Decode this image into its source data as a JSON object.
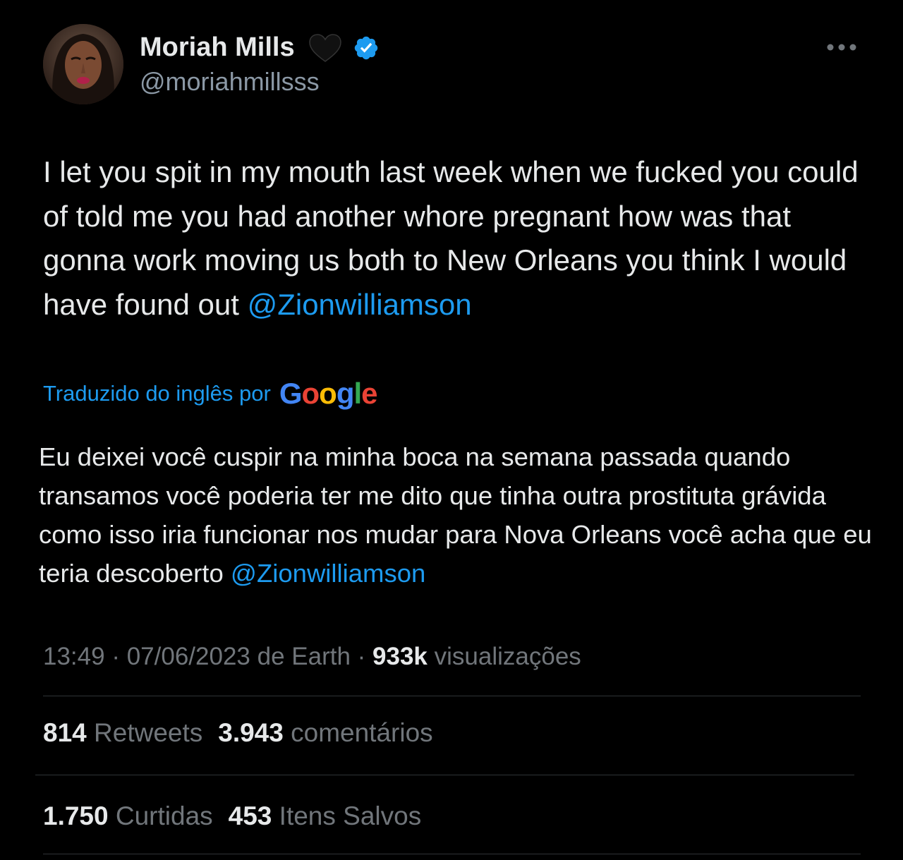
{
  "author": {
    "display_name": "Moriah Mills",
    "emoji": "🖤",
    "handle": "@moriahmillsss",
    "verified": true,
    "verified_color": "#1d9bf0"
  },
  "tweet": {
    "text": "I let you spit in my mouth last week when we fucked you could of told me you had another whore pregnant how was that gonna work moving us both to New Orleans you think I would have found out ",
    "mention": "@Zionwilliamson"
  },
  "translation": {
    "label": "Traduzido do inglês por",
    "provider": "Google",
    "text": "Eu deixei você cuspir na minha boca na semana passada quando transamos você poderia ter me dito que tinha outra prostituta grávida como isso iria funcionar nos mudar para Nova Orleans você acha que eu teria descoberto ",
    "mention": "@Zionwilliamson"
  },
  "meta": {
    "time": "13:49",
    "sep1": " · ",
    "date": "07/06/2023 de Earth",
    "sep2": " · ",
    "views_count": "933k",
    "views_label": "visualizações"
  },
  "stats": {
    "retweets_count": "814",
    "retweets_label": "Retweets",
    "comments_count": "3.943",
    "comments_label": "comentários",
    "likes_count": "1.750",
    "likes_label": "Curtidas",
    "saves_count": "453",
    "saves_label": "Itens Salvos"
  },
  "colors": {
    "background": "#000000",
    "text": "#e7e9ea",
    "secondary": "#71767b",
    "accent": "#1d9bf0"
  },
  "icons": {
    "more": "more-horizontal-icon",
    "verified": "verified-badge-icon",
    "heart": "black-heart-icon"
  }
}
